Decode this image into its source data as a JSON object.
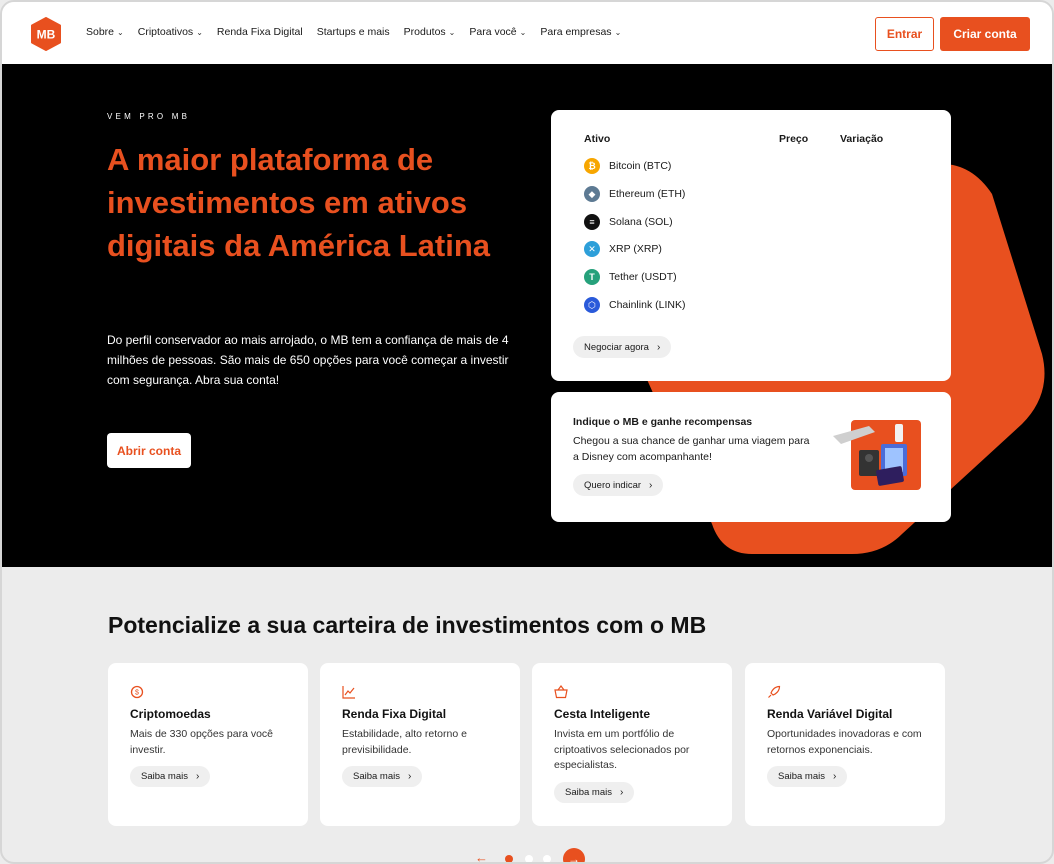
{
  "header": {
    "nav": [
      {
        "label": "Sobre",
        "has_chevron": true
      },
      {
        "label": "Criptoativos",
        "has_chevron": true
      },
      {
        "label": "Renda Fixa Digital",
        "has_chevron": false
      },
      {
        "label": "Startups e mais",
        "has_chevron": false
      },
      {
        "label": "Produtos",
        "has_chevron": true
      },
      {
        "label": "Para você",
        "has_chevron": true
      },
      {
        "label": "Para empresas",
        "has_chevron": true
      }
    ],
    "login_label": "Entrar",
    "signup_label": "Criar conta",
    "logo_text": "MB"
  },
  "hero": {
    "eyebrow": "VEM PRO MB",
    "title": "A maior plataforma de investimentos em ativos digitais da América Latina",
    "description": "Do perfil conservador ao mais arrojado, o MB tem a confiança de mais de 4 milhões de pessoas. São mais de 650 opções para você começar a investir com segurança. Abra sua conta!",
    "cta_label": "Abrir conta"
  },
  "assets_card": {
    "col_asset": "Ativo",
    "col_price": "Preço",
    "col_change": "Variação",
    "assets": [
      {
        "name": "Bitcoin (BTC)",
        "icon": "bitcoin-icon",
        "color": "#f7a600",
        "glyph": "₿"
      },
      {
        "name": "Ethereum (ETH)",
        "icon": "ethereum-icon",
        "color": "#5d7a93",
        "glyph": "◆"
      },
      {
        "name": "Solana (SOL)",
        "icon": "solana-icon",
        "color": "#111111",
        "glyph": "≡"
      },
      {
        "name": "XRP (XRP)",
        "icon": "xrp-icon",
        "color": "#2d9fd9",
        "glyph": "✕"
      },
      {
        "name": "Tether (USDT)",
        "icon": "tether-icon",
        "color": "#26a17b",
        "glyph": "T"
      },
      {
        "name": "Chainlink (LINK)",
        "icon": "chainlink-icon",
        "color": "#2a5ada",
        "glyph": "⬡"
      }
    ],
    "trade_label": "Negociar agora"
  },
  "refer_card": {
    "title": "Indique o MB e ganhe recompensas",
    "text": "Chegou a sua chance de ganhar uma viagem para a Disney com acompanhante!",
    "cta_label": "Quero indicar"
  },
  "section": {
    "title": "Potencialize a sua carteira de investimentos com o MB",
    "features": [
      {
        "title": "Criptomoedas",
        "description": "Mais de 330 opções para você investir.",
        "cta": "Saiba mais",
        "icon": "coin-icon"
      },
      {
        "title": "Renda Fixa Digital",
        "description": "Estabilidade, alto retorno e previsibilidade.",
        "cta": "Saiba mais",
        "icon": "chart-icon"
      },
      {
        "title": "Cesta Inteligente",
        "description": "Invista em um portfólio de criptoativos selecionados por especialistas.",
        "cta": "Saiba mais",
        "icon": "basket-icon"
      },
      {
        "title": "Renda Variável Digital",
        "description": "Oportunidades inovadoras e com retornos exponenciais.",
        "cta": "Saiba mais",
        "icon": "rocket-icon"
      }
    ]
  },
  "colors": {
    "brand": "#e8501f",
    "hero_bg": "#000000",
    "section_bg": "#ececec"
  }
}
